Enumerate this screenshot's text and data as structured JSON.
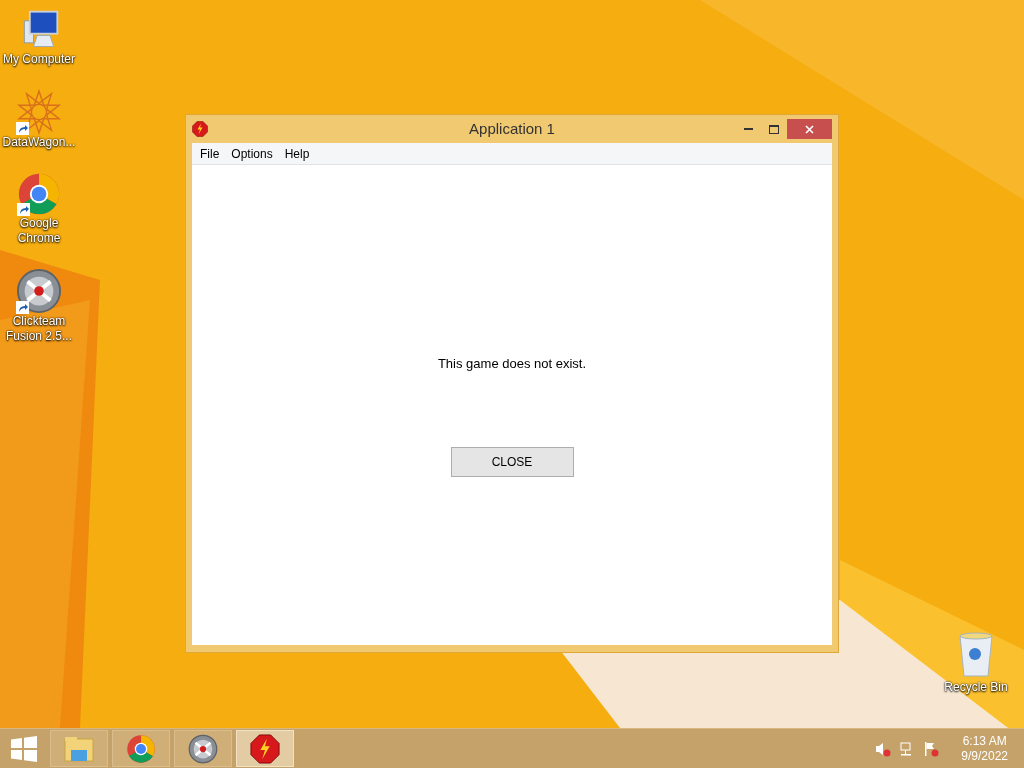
{
  "desktop_icons": [
    {
      "kind": "computer",
      "label": "My Computer",
      "shortcut": false
    },
    {
      "kind": "star",
      "label": "DataWagon...",
      "shortcut": true
    },
    {
      "kind": "chrome",
      "label": "Google Chrome",
      "shortcut": true
    },
    {
      "kind": "clickteam",
      "label": "Clickteam Fusion 2.5...",
      "shortcut": true
    }
  ],
  "recycle_bin": {
    "label": "Recycle Bin"
  },
  "window": {
    "title": "Application 1",
    "menu": [
      "File",
      "Options",
      "Help"
    ],
    "message": "This game does not exist.",
    "button": "CLOSE"
  },
  "taskbar": {
    "items": [
      {
        "kind": "explorer",
        "active": false
      },
      {
        "kind": "chrome",
        "active": false
      },
      {
        "kind": "clickteam",
        "active": false
      },
      {
        "kind": "app",
        "active": true
      }
    ],
    "time": "6:13 AM",
    "date": "9/9/2022"
  }
}
